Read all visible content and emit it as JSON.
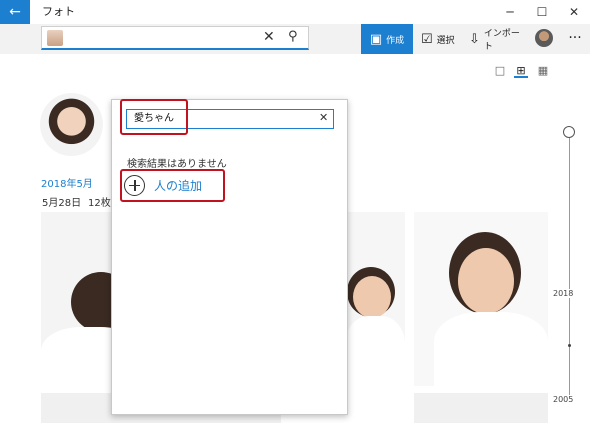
{
  "window": {
    "title": "フォト",
    "controls": {
      "minimize": "─",
      "maximize": "☐",
      "close": "✕"
    },
    "back_icon": "←"
  },
  "toolbar": {
    "search_clear_icon": "✕",
    "search_icon": "⚲",
    "create_label": "作成",
    "select_label": "選択",
    "import_label": "インポート",
    "more_label": "···"
  },
  "view": {
    "options": [
      "single",
      "grid-medium",
      "grid-small"
    ],
    "selected": "grid-medium"
  },
  "person": {
    "date_heading": "2018年5月",
    "date_sub": "5月28日",
    "count": "12枚"
  },
  "timeline": {
    "top_year": "2018",
    "bottom_year": "2005"
  },
  "popup": {
    "input_value": "愛ちゃん",
    "clear_icon": "✕",
    "no_results": "検索結果はありません",
    "add_person_label": "人の追加"
  },
  "colors": {
    "accent": "#1c7fcf",
    "highlight": "#c1121f",
    "toolbar_bg": "#f2f2f2"
  }
}
